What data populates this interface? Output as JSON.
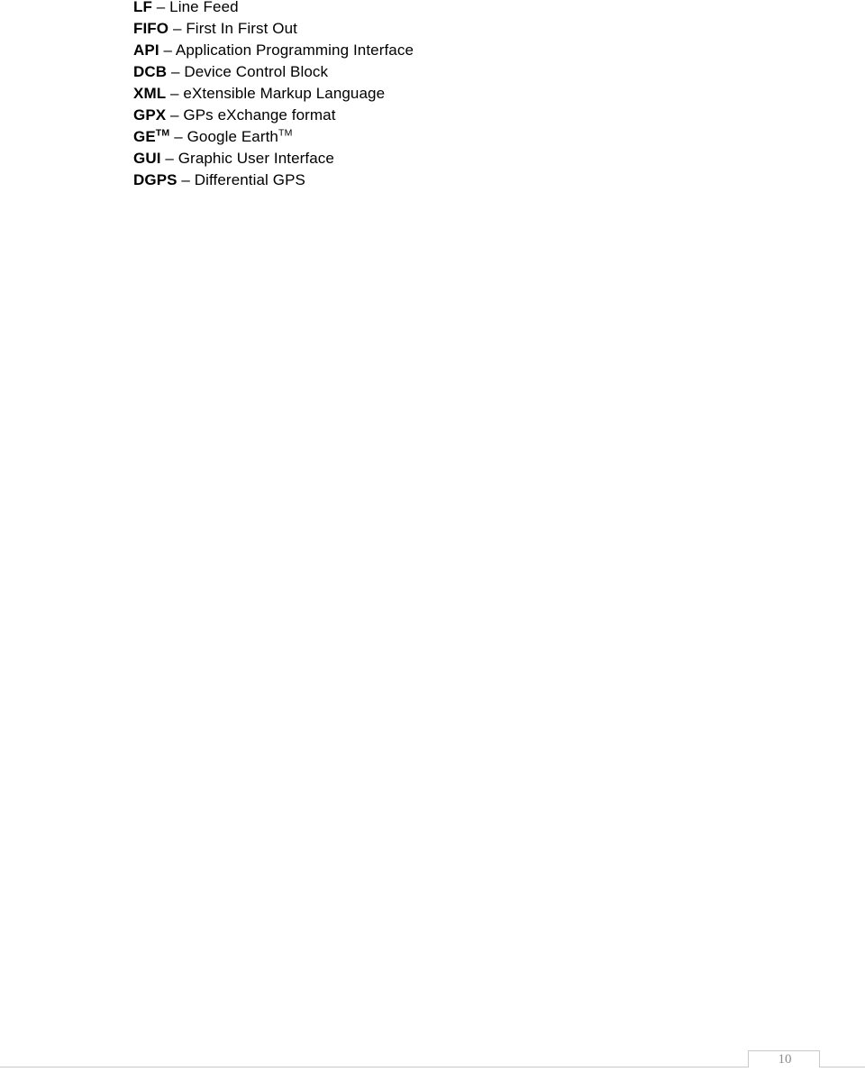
{
  "document": {
    "abbreviations": [
      {
        "term": "LF",
        "term_sup": "",
        "dash": " – ",
        "definition": "Line Feed",
        "definition_sup": ""
      },
      {
        "term": "FIFO",
        "term_sup": "",
        "dash": " – ",
        "definition": "First In First Out",
        "definition_sup": ""
      },
      {
        "term": "API",
        "term_sup": "",
        "dash": " – ",
        "definition": "Application Programming Interface",
        "definition_sup": ""
      },
      {
        "term": "DCB",
        "term_sup": "",
        "dash": " – ",
        "definition": "Device Control Block",
        "definition_sup": ""
      },
      {
        "term": "XML",
        "term_sup": "",
        "dash": " – ",
        "definition": "eXtensible Markup Language",
        "definition_sup": ""
      },
      {
        "term": "GPX",
        "term_sup": "",
        "dash": " – ",
        "definition": "GPs eXchange format",
        "definition_sup": ""
      },
      {
        "term": "GE",
        "term_sup": "TM",
        "dash": " – ",
        "definition": "Google Earth",
        "definition_sup": "TM"
      },
      {
        "term": "GUI",
        "term_sup": "",
        "dash": " – ",
        "definition": "Graphic User Interface",
        "definition_sup": ""
      },
      {
        "term": "DGPS",
        "term_sup": "",
        "dash": " – ",
        "definition": "Differential GPS",
        "definition_sup": ""
      }
    ],
    "footer": {
      "page_number": "10"
    },
    "colors": {
      "text": "#000000",
      "rule": "#c9c9c9",
      "page_number": "#8c8c8c",
      "background": "#ffffff"
    }
  }
}
